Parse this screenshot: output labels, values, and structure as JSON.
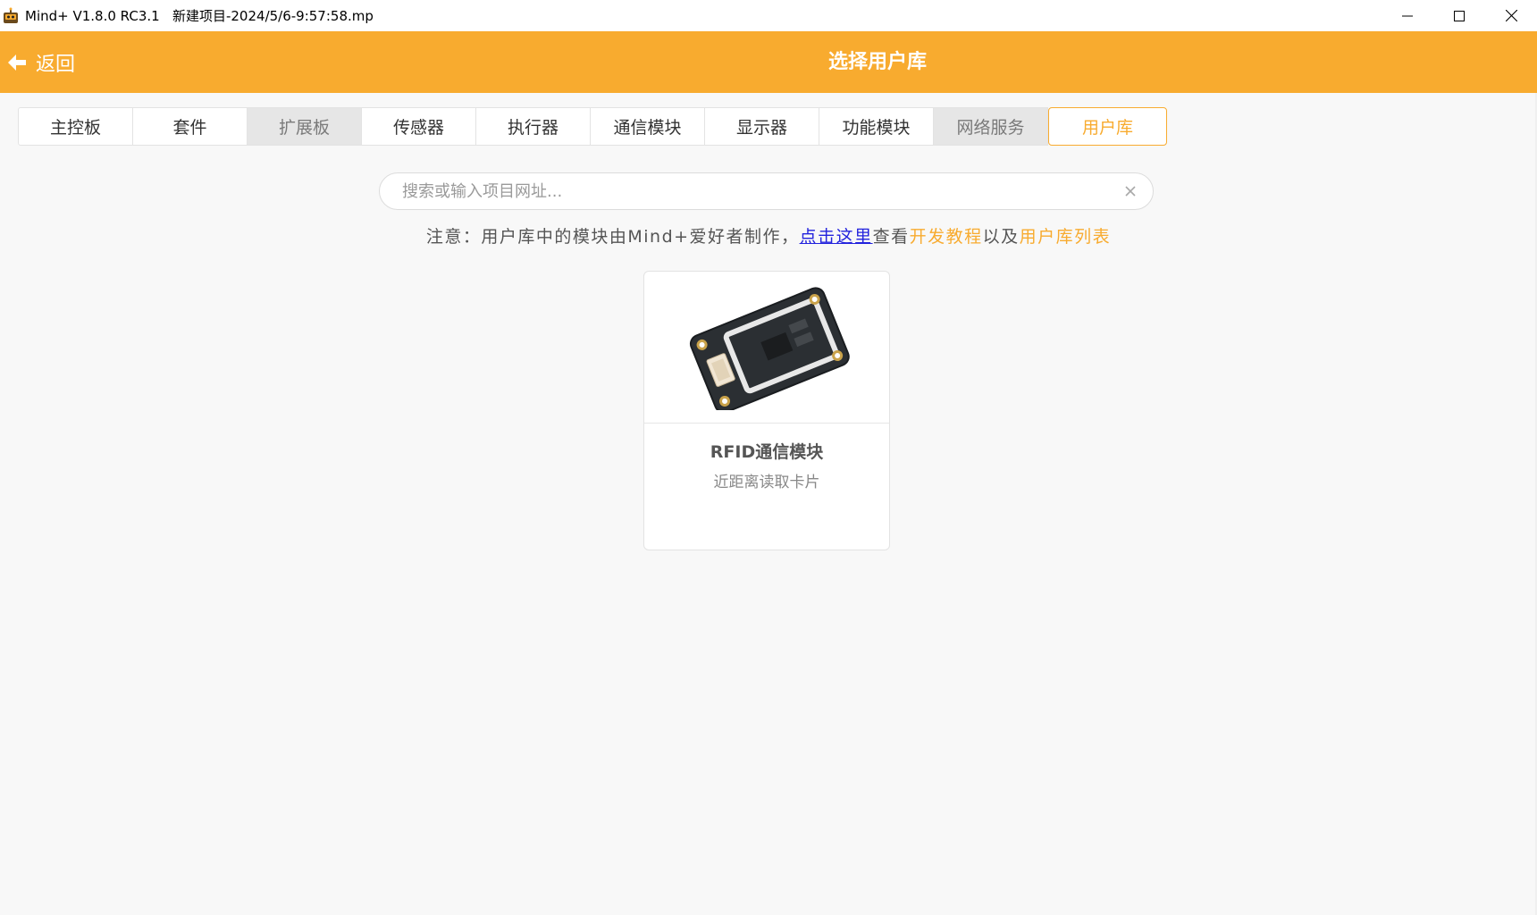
{
  "window": {
    "title": "Mind+ V1.8.0 RC3.1   新建项目-2024/5/6-9:57:58.mp",
    "app_icon": "mindplus-robot-icon",
    "controls": [
      "minimize-icon",
      "maximize-icon",
      "close-icon"
    ]
  },
  "header": {
    "back_label": "返回",
    "back_icon": "arrow-left-icon",
    "title": "选择用户库",
    "color": "#f8ab2f"
  },
  "tabs": [
    {
      "label": "主控板",
      "state": "normal"
    },
    {
      "label": "套件",
      "state": "normal"
    },
    {
      "label": "扩展板",
      "state": "disabled"
    },
    {
      "label": "传感器",
      "state": "normal"
    },
    {
      "label": "执行器",
      "state": "normal"
    },
    {
      "label": "通信模块",
      "state": "normal"
    },
    {
      "label": "显示器",
      "state": "normal"
    },
    {
      "label": "功能模块",
      "state": "normal"
    },
    {
      "label": "网络服务",
      "state": "disabled"
    },
    {
      "label": "用户库",
      "state": "active"
    }
  ],
  "search": {
    "placeholder": "搜索或输入项目网址...",
    "value": "",
    "clear_icon": "close-icon"
  },
  "notice": {
    "prefix": "注意：用户库中的模块由Mind+爱好者制作，",
    "link_here": "点击这里",
    "middle": "查看",
    "link_tutorial": "开发教程",
    "conj": "以及",
    "link_list": "用户库列表"
  },
  "cards": [
    {
      "title": "RFID通信模块",
      "description": "近距离读取卡片",
      "image": "rfid-module-board"
    }
  ]
}
